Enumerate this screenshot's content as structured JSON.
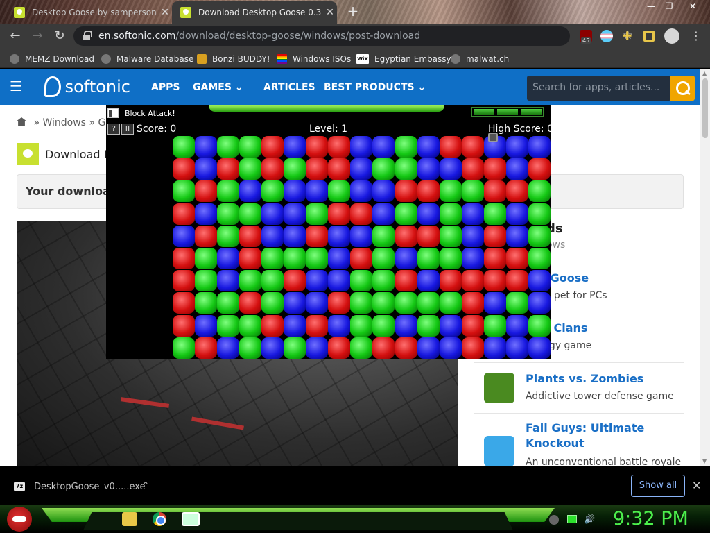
{
  "browser": {
    "tabs": [
      {
        "title": "Desktop Goose by samperson",
        "active": false
      },
      {
        "title": "Download Desktop Goose 0.3 - f",
        "active": true
      }
    ],
    "new_tab": "+",
    "window_controls": {
      "minimize": "—",
      "maximize": "❐",
      "close": "✕"
    },
    "nav": {
      "back": "←",
      "forward": "→",
      "reload": "↻"
    },
    "address": {
      "host": "en.softonic.com",
      "path": "/download/desktop-goose/windows/post-download"
    },
    "extension_badge": "45",
    "bookmarks": [
      {
        "label": "MEMZ Download",
        "icon": "globe-icon"
      },
      {
        "label": "Malware Database",
        "icon": "globe-icon"
      },
      {
        "label": "Bonzi BUDDY!",
        "icon": "bonzi-icon"
      },
      {
        "label": "Windows ISOs",
        "icon": "rainbow-icon"
      },
      {
        "label": "Egyptian Embassy",
        "icon": "wix-icon"
      },
      {
        "label": "malwat.ch",
        "icon": "globe-icon"
      }
    ],
    "menu": "⋮"
  },
  "site": {
    "logo": "softonic",
    "nav_links": [
      "APPS",
      "GAMES",
      "ARTICLES",
      "BEST PRODUCTS"
    ],
    "search_placeholder": "Search for apps, articles...",
    "breadcrumb": [
      "Windows",
      "Ga"
    ],
    "download_heading_prefix": "Download",
    "download_heading_bold": "D",
    "download_box_text": "Your download",
    "aside": {
      "title_fragment": "ds",
      "subtitle_fragment": "ows",
      "items": [
        {
          "name": "top Goose",
          "desc": "irtual pet for PCs",
          "color": "#c8e030"
        },
        {
          "name": "h of Clans",
          "desc": "trategy game",
          "color": "#e8a020"
        },
        {
          "name": "Plants vs. Zombies",
          "desc": "Addictive tower defense game",
          "color": "#4a8a20"
        },
        {
          "name": "Fall Guys: Ultimate Knockout",
          "desc": "An unconventional battle royale",
          "color": "#3aa8e8"
        }
      ]
    }
  },
  "game": {
    "window_title": "Block Attack!",
    "help_label": "?",
    "pause_label": "II",
    "score_label": "Score: 0",
    "level_label": "Level: 1",
    "high_score_label": "High Score: 0",
    "colors": {
      "r": "#e01010",
      "g": "#12c812",
      "b": "#1818e0"
    },
    "grid": [
      "gbggrbrrbbgbrrbbb",
      "rbrgrgrrbggbbrrbr",
      "grgbgbbgbbrrggrrg",
      "rbggbbgrrbgbgbgbg",
      "brgrbbrbbgrrgbrbg",
      "rgbrgggbrgbggbrrg",
      "rgbggrbbggrbrrrrb",
      "rggrgbbrgggggrbgb",
      "rbggrbrbggbgbrgbg",
      "grbgbgbrgrrbbrbbb"
    ]
  },
  "downloads": {
    "file": "DesktopGoose_v0.....exe",
    "show_all": "Show all",
    "close": "✕",
    "chevron": "⌃"
  },
  "taskbar": {
    "clock": "9:32 PM"
  }
}
